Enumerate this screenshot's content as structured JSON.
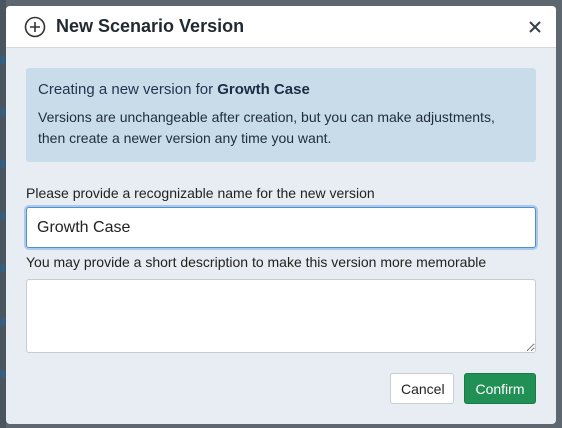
{
  "dialog": {
    "title": "New Scenario Version",
    "header_icon": "plus-circle-icon",
    "close_icon": "close-icon"
  },
  "info": {
    "title_prefix": "Creating a new version for ",
    "title_name": "Growth Case",
    "text": "Versions are unchangeable after creation, but you can make adjustments, then create a newer version any time you want."
  },
  "name_field": {
    "label": "Please provide a recognizable name for the new version",
    "value": "Growth Case"
  },
  "description_field": {
    "label": "You may provide a short description to make this version more memorable",
    "value": ""
  },
  "buttons": {
    "cancel": "Cancel",
    "confirm": "Confirm"
  },
  "colors": {
    "info_bg": "#c9dce9",
    "confirm_bg": "#219055",
    "focus_border": "#4f8fd0"
  }
}
